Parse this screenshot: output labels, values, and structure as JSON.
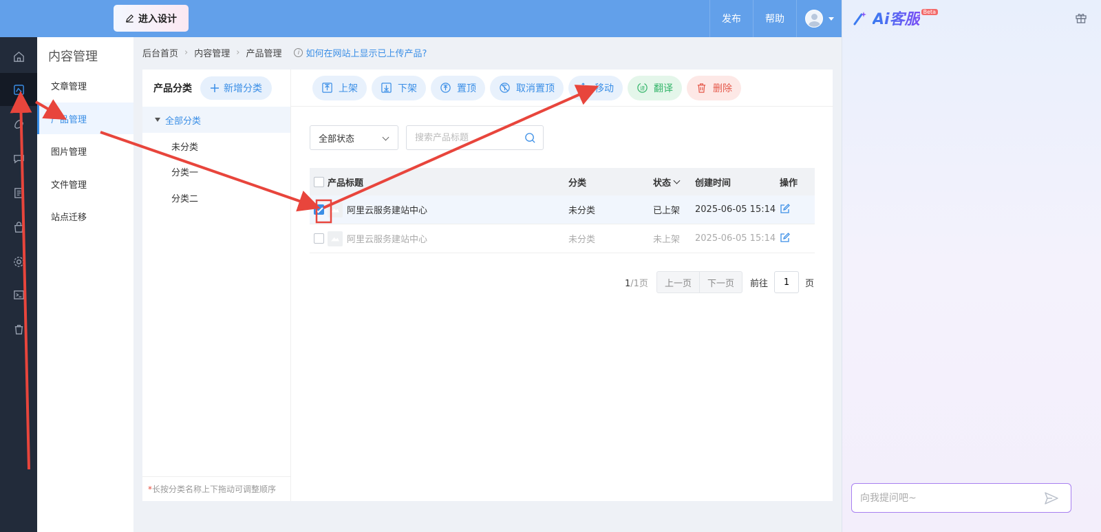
{
  "header": {
    "design_button": "进入设计",
    "nav": [
      "发布",
      "帮助"
    ]
  },
  "rail": {
    "items": [
      "home-icon",
      "content-icon",
      "theme-icon",
      "chat-icon",
      "list-icon",
      "shop-icon",
      "gear-icon",
      "terminal-icon",
      "trash-icon"
    ],
    "active_index": 1
  },
  "submenu": {
    "title": "内容管理",
    "items": [
      "文章管理",
      "产品管理",
      "图片管理",
      "文件管理",
      "站点迁移"
    ],
    "active_index": 1
  },
  "breadcrumb": {
    "items": [
      "后台首页",
      "内容管理",
      "产品管理"
    ],
    "help_link": "如何在网站上显示已上传产品?"
  },
  "categories": {
    "title": "产品分类",
    "add_button": "新增分类",
    "root": "全部分类",
    "children": [
      "未分类",
      "分类一",
      "分类二"
    ],
    "tip_star": "*",
    "tip": "长按分类名称上下拖动可调整顺序"
  },
  "toolbar": {
    "buttons": [
      "上架",
      "下架",
      "置顶",
      "取消置顶",
      "移动",
      "翻译",
      "删除"
    ]
  },
  "filters": {
    "status_select": "全部状态",
    "search_placeholder": "搜索产品标题"
  },
  "table": {
    "headers": {
      "title": "产品标题",
      "category": "分类",
      "status": "状态",
      "created": "创建时间",
      "action": "操作"
    },
    "rows": [
      {
        "title": "阿里云服务建站中心",
        "category": "未分类",
        "status": "已上架",
        "created": "2025-06-05 15:14",
        "checked": true
      },
      {
        "title": "阿里云服务建站中心",
        "category": "未分类",
        "status": "未上架",
        "created": "2025-06-05 15:14",
        "checked": false
      }
    ]
  },
  "pagination": {
    "current": "1",
    "total": "/1页",
    "prev": "上一页",
    "next": "下一页",
    "goto_label": "前往",
    "goto_value": "1",
    "page_suffix": "页"
  },
  "ai": {
    "logo_text": "Ai客服",
    "beta": "Beta",
    "input_placeholder": "向我提问吧~"
  },
  "colors": {
    "header_bg": "#62a0ea",
    "accent": "#3a8ee6",
    "rail_bg": "#222b3a",
    "annotation": "#e8453c"
  }
}
